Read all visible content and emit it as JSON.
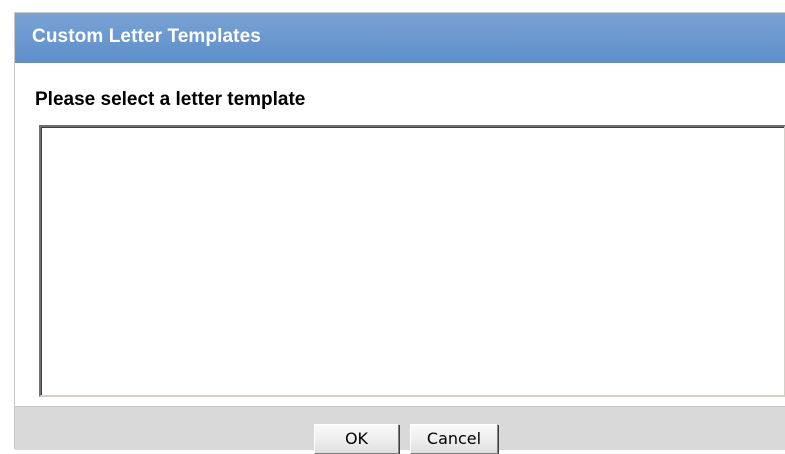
{
  "dialog": {
    "title": "Custom Letter Templates",
    "prompt": "Please select a letter template",
    "template_list": {
      "items": []
    },
    "buttons": {
      "ok_label": "OK",
      "cancel_label": "Cancel"
    }
  },
  "colors": {
    "titlebar": "#6a98cf",
    "titlebar_text": "#ffffff",
    "footer": "#d9d9d9"
  }
}
